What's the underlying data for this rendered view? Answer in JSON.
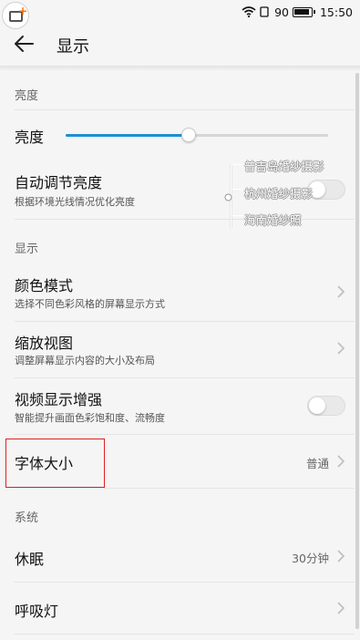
{
  "status_bar": {
    "battery": "90",
    "time": "15:50"
  },
  "header": {
    "title": "显示"
  },
  "sections": {
    "brightness": "亮度",
    "display": "显示",
    "system": "系统"
  },
  "brightness": {
    "label": "亮度",
    "level": 0.47
  },
  "auto_brightness": {
    "title": "自动调节亮度",
    "subtitle": "根据环境光线情况优化亮度",
    "enabled": false
  },
  "color_mode": {
    "title": "颜色模式",
    "subtitle": "选择不同色彩风格的屏幕显示方式"
  },
  "zoom_view": {
    "title": "缩放视图",
    "subtitle": "调整屏幕显示内容的大小及布局"
  },
  "video_enhance": {
    "title": "视频显示增强",
    "subtitle": "智能提升画面色彩饱和度、流畅度",
    "enabled": false
  },
  "font_size": {
    "title": "字体大小",
    "value": "普通"
  },
  "sleep": {
    "title": "休眠",
    "value": "30分钟"
  },
  "breathing_light": {
    "title": "呼吸灯"
  },
  "watermark": {
    "lines": [
      "普吉岛婚纱摄影",
      "杭州婚纱摄影",
      "海南婚纱照"
    ]
  },
  "colors": {
    "accent": "#1b8fd6",
    "highlight": "#e02020",
    "background": "#f5f5f5"
  }
}
